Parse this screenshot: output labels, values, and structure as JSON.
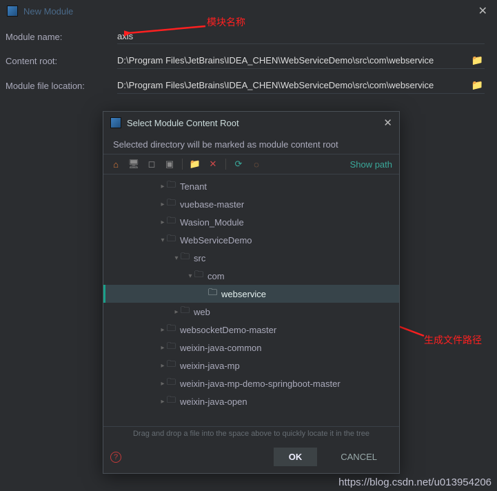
{
  "window": {
    "title": "New Module"
  },
  "form": {
    "name_label": "Module name:",
    "name_value": "axis",
    "root_label": "Content root:",
    "root_value": "D:\\Program Files\\JetBrains\\IDEA_CHEN\\WebServiceDemo\\src\\com\\webservice",
    "loc_label": "Module file location:",
    "loc_value": "D:\\Program Files\\JetBrains\\IDEA_CHEN\\WebServiceDemo\\src\\com\\webservice"
  },
  "anno": {
    "a1": "模块名称",
    "a2": "生成文件路径"
  },
  "dialog": {
    "title": "Select Module Content Root",
    "subtitle": "Selected directory will be marked as module content root",
    "show_path": "Show path",
    "hint": "Drag and drop a file into the space above to quickly locate it in the tree",
    "ok": "OK",
    "cancel": "CANCEL"
  },
  "tree": [
    {
      "indent": 80,
      "expand": "right",
      "label": "Tenant"
    },
    {
      "indent": 80,
      "expand": "right",
      "label": "vuebase-master"
    },
    {
      "indent": 80,
      "expand": "right",
      "label": "Wasion_Module"
    },
    {
      "indent": 80,
      "expand": "down",
      "label": "WebServiceDemo"
    },
    {
      "indent": 100,
      "expand": "down",
      "label": "src"
    },
    {
      "indent": 120,
      "expand": "down",
      "label": "com"
    },
    {
      "indent": 140,
      "expand": "none",
      "label": "webservice",
      "selected": true
    },
    {
      "indent": 100,
      "expand": "right",
      "label": "web"
    },
    {
      "indent": 80,
      "expand": "right",
      "label": "websocketDemo-master"
    },
    {
      "indent": 80,
      "expand": "right",
      "label": "weixin-java-common"
    },
    {
      "indent": 80,
      "expand": "right",
      "label": "weixin-java-mp"
    },
    {
      "indent": 80,
      "expand": "right",
      "label": "weixin-java-mp-demo-springboot-master"
    },
    {
      "indent": 80,
      "expand": "right",
      "label": "weixin-java-open"
    }
  ],
  "watermark": "https://blog.csdn.net/u013954206"
}
